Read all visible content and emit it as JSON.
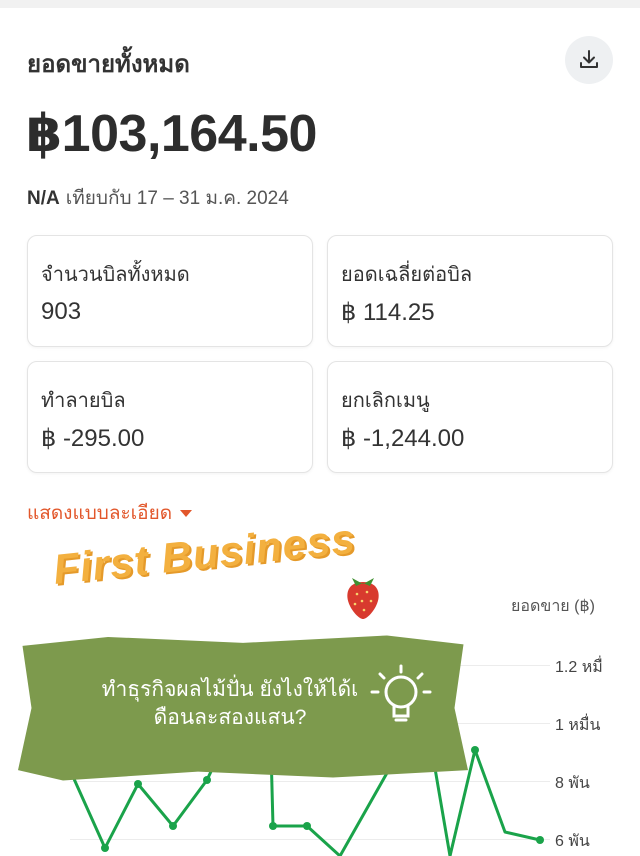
{
  "header": {
    "title": "ยอดขายทั้งหมด",
    "download_icon": "download-icon"
  },
  "total": {
    "amount": "฿103,164.50"
  },
  "comparison": {
    "change": "N/A",
    "text": "เทียบกับ 17 – 31 ม.ค. 2024"
  },
  "cards": [
    {
      "label": "จำนวนบิลทั้งหมด",
      "value": "903"
    },
    {
      "label": "ยอดเฉลี่ยต่อบิล",
      "value": "฿ 114.25"
    },
    {
      "label": "ทำลายบิล",
      "value": "฿ -295.00"
    },
    {
      "label": "ยกเลิกเมนู",
      "value": "฿ -1,244.00"
    }
  ],
  "details_link": "แสดงแบบละเอียด",
  "overlay": {
    "title": "First Business",
    "line1": "ทำธุรกิจผลไม้ปั่น ยังไงให้ได้เ",
    "line2": "ดือนละสองแสน?"
  },
  "chart_data": {
    "type": "line",
    "ylabel": "ยอดขาย (฿)",
    "y_ticks": [
      "1.2 หมื่",
      "1 หมื่น",
      "8 พัน",
      "6 พัน"
    ],
    "color": "#1aa34a"
  }
}
